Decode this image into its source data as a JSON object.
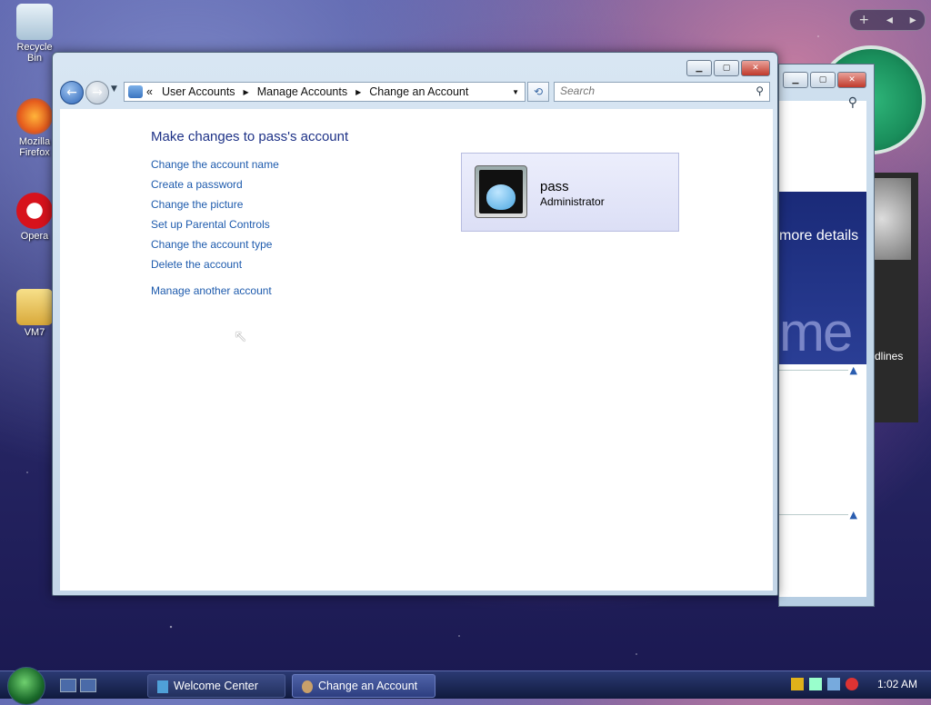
{
  "desktop": {
    "icons": [
      {
        "label": "Recycle Bin"
      },
      {
        "label": "Mozilla Firefox"
      },
      {
        "label": "Opera"
      },
      {
        "label": "VM7"
      }
    ]
  },
  "background_window": {
    "banner_text": "more details",
    "banner_large_text": "me",
    "headlines_label": "dlines"
  },
  "window": {
    "breadcrumb": [
      "User Accounts",
      "Manage Accounts",
      "Change an Account"
    ],
    "breadcrumb_prefix": "«",
    "search_placeholder": "Search"
  },
  "content": {
    "heading": "Make changes to pass's account",
    "links": [
      "Change the account name",
      "Create a password",
      "Change the picture",
      "Set up Parental Controls",
      "Change the account type",
      "Delete the account"
    ],
    "manage_other": "Manage another account"
  },
  "account": {
    "name": "pass",
    "type": "Administrator"
  },
  "taskbar": {
    "tasks": [
      "Welcome Center",
      "Change an Account"
    ],
    "clock": "1:02 AM"
  },
  "colors": {
    "link": "#1e5bad",
    "heading": "#1e3287"
  }
}
